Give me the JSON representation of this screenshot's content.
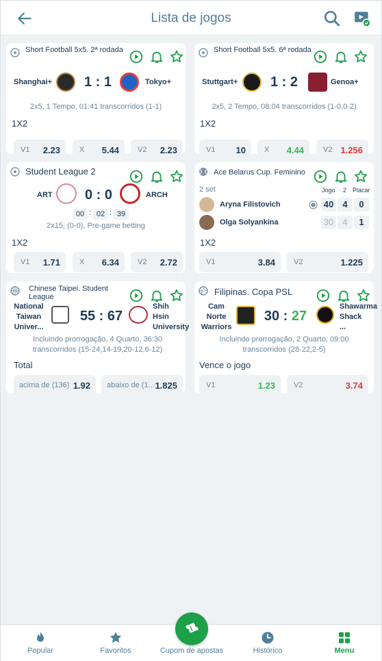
{
  "header": {
    "title": "Lista de jogos"
  },
  "colors": {
    "accent": "#1ea04a",
    "header_text": "#4f7f99",
    "up": "#3cb45a",
    "down": "#e0373a"
  },
  "cards": [
    {
      "league": "Short Football 5x5. 2ª rodada",
      "sport_icon": "football-icon",
      "team1": "Shanghai+",
      "team2": "Tokyo+",
      "score": "1 : 1",
      "info": "2x5, 1 Tempo, 01:41 transcorridos (1-1)",
      "market": "1X2",
      "odds": [
        {
          "label": "V1",
          "value": "2.23"
        },
        {
          "label": "X",
          "value": "5.44"
        },
        {
          "label": "V2",
          "value": "2.23"
        }
      ]
    },
    {
      "league": "Short Football 5x5. 6ª rodada",
      "sport_icon": "football-icon",
      "team1": "Stuttgart+",
      "team2": "Genoa+",
      "score": "1 : 2",
      "info": "2x5, 2 Tempo, 08:04 transcorridos (1-0,0-2)",
      "market": "1X2",
      "odds": [
        {
          "label": "V1",
          "value": "10"
        },
        {
          "label": "X",
          "value": "4.44"
        },
        {
          "label": "V2",
          "value": "1.256"
        }
      ]
    },
    {
      "league": "Student League 2",
      "sport_icon": "football-icon",
      "team1": "ART",
      "team2": "ARCH",
      "score": "0 : 0",
      "timer": [
        "00",
        "02",
        "39"
      ],
      "info": "2x15, (0-0), Pre-game betting",
      "market": "1X2",
      "odds": [
        {
          "label": "V1",
          "value": "1.71"
        },
        {
          "label": "X",
          "value": "6.34"
        },
        {
          "label": "V2",
          "value": "2.72"
        }
      ]
    },
    {
      "league": "Ace Belarus Cup. Feminino",
      "sport_icon": "tennis-icon",
      "set_label": "2 set",
      "columns": [
        "Jogo",
        "2",
        "Placar"
      ],
      "player1": "Aryna Filistovich",
      "player2": "Olga Solyankina",
      "p1_scores": [
        "40",
        "4",
        "0"
      ],
      "p2_scores": [
        "30",
        "4",
        "1"
      ],
      "market": "1X2",
      "odds": [
        {
          "label": "V1",
          "value": "3.84"
        },
        {
          "label": "V2",
          "value": "1.225"
        }
      ]
    },
    {
      "league": "Chinese Taipei. Student League",
      "sport_icon": "basketball-icon",
      "team1": "National Taiwan Univer...",
      "team2": "Shih Hsin University",
      "score1": "55",
      "score_sep": ":",
      "score2": "67",
      "info": "Incluindo prorrogação, 4 Quarto, 36:30 transcorridos (15-24,14-19,20-12,6-12)",
      "market": "Total",
      "odds": [
        {
          "label": "acima de (136)",
          "value": "1.92"
        },
        {
          "label": "abaixo de (1...",
          "value": "1.825"
        }
      ]
    },
    {
      "league": "Filipinas. Copa PSL",
      "sport_icon": "volleyball-icon",
      "team1": "Cam Norte Warriors",
      "team2": "Shawarma Shack ...",
      "score1": "30",
      "score_sep": ":",
      "score2": "27",
      "info": "Incluindo prorrogação, 2 Quarto, 09:00 transcorridos (28-22,2-5)",
      "market": "Vence o jogo",
      "odds": [
        {
          "label": "V1",
          "value": "1.23"
        },
        {
          "label": "V2",
          "value": "3.74"
        }
      ]
    }
  ],
  "nav": [
    {
      "label": "Popular",
      "icon": "flame-icon"
    },
    {
      "label": "Favoritos",
      "icon": "star-icon"
    },
    {
      "label": "Cupom de apostas",
      "icon": "ticket-icon"
    },
    {
      "label": "Histórico",
      "icon": "clock-icon"
    },
    {
      "label": "Menu",
      "icon": "grid-icon"
    }
  ]
}
